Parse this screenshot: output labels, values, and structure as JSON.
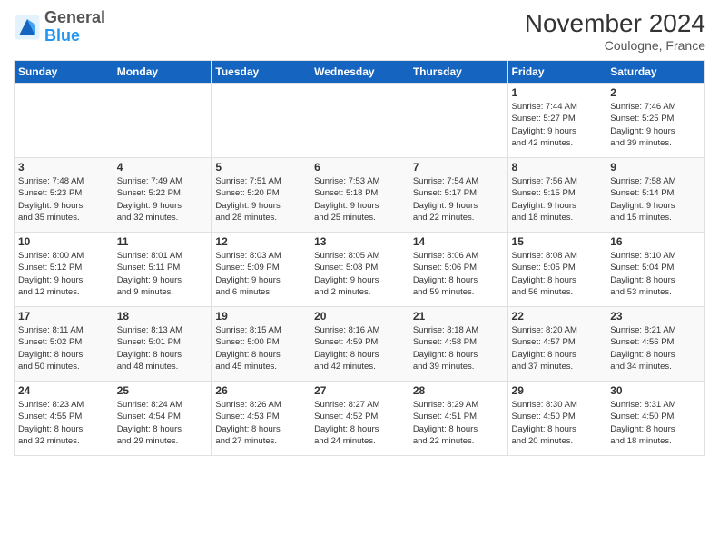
{
  "header": {
    "logo_general": "General",
    "logo_blue": "Blue",
    "month_title": "November 2024",
    "location": "Coulogne, France"
  },
  "weekdays": [
    "Sunday",
    "Monday",
    "Tuesday",
    "Wednesday",
    "Thursday",
    "Friday",
    "Saturday"
  ],
  "weeks": [
    [
      {
        "day": "",
        "info": ""
      },
      {
        "day": "",
        "info": ""
      },
      {
        "day": "",
        "info": ""
      },
      {
        "day": "",
        "info": ""
      },
      {
        "day": "",
        "info": ""
      },
      {
        "day": "1",
        "info": "Sunrise: 7:44 AM\nSunset: 5:27 PM\nDaylight: 9 hours\nand 42 minutes."
      },
      {
        "day": "2",
        "info": "Sunrise: 7:46 AM\nSunset: 5:25 PM\nDaylight: 9 hours\nand 39 minutes."
      }
    ],
    [
      {
        "day": "3",
        "info": "Sunrise: 7:48 AM\nSunset: 5:23 PM\nDaylight: 9 hours\nand 35 minutes."
      },
      {
        "day": "4",
        "info": "Sunrise: 7:49 AM\nSunset: 5:22 PM\nDaylight: 9 hours\nand 32 minutes."
      },
      {
        "day": "5",
        "info": "Sunrise: 7:51 AM\nSunset: 5:20 PM\nDaylight: 9 hours\nand 28 minutes."
      },
      {
        "day": "6",
        "info": "Sunrise: 7:53 AM\nSunset: 5:18 PM\nDaylight: 9 hours\nand 25 minutes."
      },
      {
        "day": "7",
        "info": "Sunrise: 7:54 AM\nSunset: 5:17 PM\nDaylight: 9 hours\nand 22 minutes."
      },
      {
        "day": "8",
        "info": "Sunrise: 7:56 AM\nSunset: 5:15 PM\nDaylight: 9 hours\nand 18 minutes."
      },
      {
        "day": "9",
        "info": "Sunrise: 7:58 AM\nSunset: 5:14 PM\nDaylight: 9 hours\nand 15 minutes."
      }
    ],
    [
      {
        "day": "10",
        "info": "Sunrise: 8:00 AM\nSunset: 5:12 PM\nDaylight: 9 hours\nand 12 minutes."
      },
      {
        "day": "11",
        "info": "Sunrise: 8:01 AM\nSunset: 5:11 PM\nDaylight: 9 hours\nand 9 minutes."
      },
      {
        "day": "12",
        "info": "Sunrise: 8:03 AM\nSunset: 5:09 PM\nDaylight: 9 hours\nand 6 minutes."
      },
      {
        "day": "13",
        "info": "Sunrise: 8:05 AM\nSunset: 5:08 PM\nDaylight: 9 hours\nand 2 minutes."
      },
      {
        "day": "14",
        "info": "Sunrise: 8:06 AM\nSunset: 5:06 PM\nDaylight: 8 hours\nand 59 minutes."
      },
      {
        "day": "15",
        "info": "Sunrise: 8:08 AM\nSunset: 5:05 PM\nDaylight: 8 hours\nand 56 minutes."
      },
      {
        "day": "16",
        "info": "Sunrise: 8:10 AM\nSunset: 5:04 PM\nDaylight: 8 hours\nand 53 minutes."
      }
    ],
    [
      {
        "day": "17",
        "info": "Sunrise: 8:11 AM\nSunset: 5:02 PM\nDaylight: 8 hours\nand 50 minutes."
      },
      {
        "day": "18",
        "info": "Sunrise: 8:13 AM\nSunset: 5:01 PM\nDaylight: 8 hours\nand 48 minutes."
      },
      {
        "day": "19",
        "info": "Sunrise: 8:15 AM\nSunset: 5:00 PM\nDaylight: 8 hours\nand 45 minutes."
      },
      {
        "day": "20",
        "info": "Sunrise: 8:16 AM\nSunset: 4:59 PM\nDaylight: 8 hours\nand 42 minutes."
      },
      {
        "day": "21",
        "info": "Sunrise: 8:18 AM\nSunset: 4:58 PM\nDaylight: 8 hours\nand 39 minutes."
      },
      {
        "day": "22",
        "info": "Sunrise: 8:20 AM\nSunset: 4:57 PM\nDaylight: 8 hours\nand 37 minutes."
      },
      {
        "day": "23",
        "info": "Sunrise: 8:21 AM\nSunset: 4:56 PM\nDaylight: 8 hours\nand 34 minutes."
      }
    ],
    [
      {
        "day": "24",
        "info": "Sunrise: 8:23 AM\nSunset: 4:55 PM\nDaylight: 8 hours\nand 32 minutes."
      },
      {
        "day": "25",
        "info": "Sunrise: 8:24 AM\nSunset: 4:54 PM\nDaylight: 8 hours\nand 29 minutes."
      },
      {
        "day": "26",
        "info": "Sunrise: 8:26 AM\nSunset: 4:53 PM\nDaylight: 8 hours\nand 27 minutes."
      },
      {
        "day": "27",
        "info": "Sunrise: 8:27 AM\nSunset: 4:52 PM\nDaylight: 8 hours\nand 24 minutes."
      },
      {
        "day": "28",
        "info": "Sunrise: 8:29 AM\nSunset: 4:51 PM\nDaylight: 8 hours\nand 22 minutes."
      },
      {
        "day": "29",
        "info": "Sunrise: 8:30 AM\nSunset: 4:50 PM\nDaylight: 8 hours\nand 20 minutes."
      },
      {
        "day": "30",
        "info": "Sunrise: 8:31 AM\nSunset: 4:50 PM\nDaylight: 8 hours\nand 18 minutes."
      }
    ]
  ]
}
